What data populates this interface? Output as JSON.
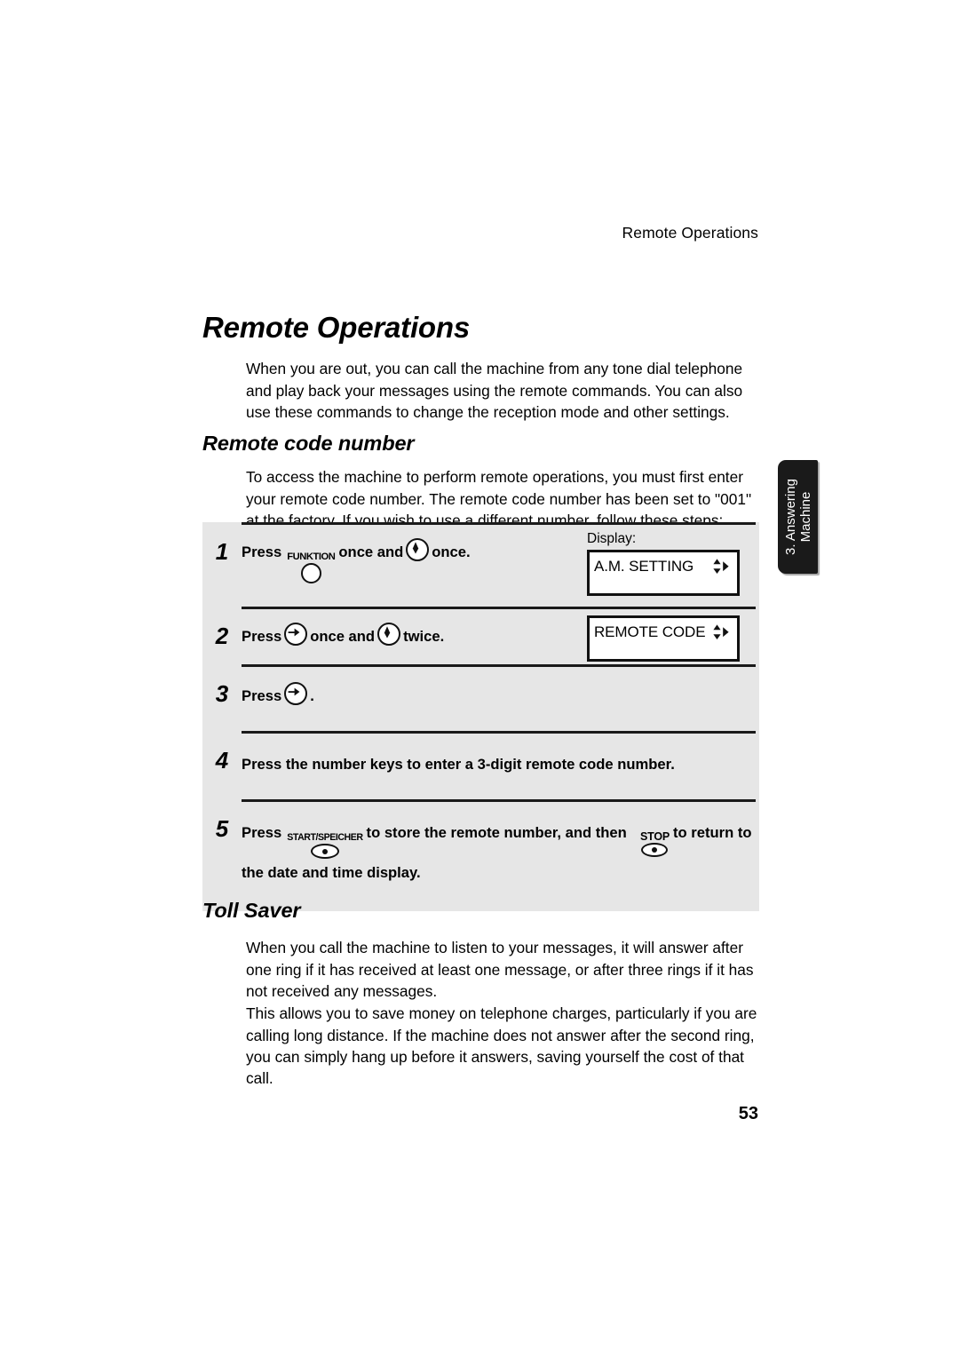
{
  "header": {
    "running_title": "Remote Operations"
  },
  "chapter": {
    "title": "Remote Operations"
  },
  "intro": {
    "paragraph": "When you are out, you can call the machine from any tone dial telephone and play back your messages using the remote commands. You can also use these commands to change the reception mode and other settings."
  },
  "remote_code": {
    "heading": "Remote code number",
    "paragraph": "To access the machine to perform remote operations, you must first enter your remote code number. The remote code number has been set to \"001\" at the factory. If you wish to use a different number, follow these steps:",
    "display_label": "Display:",
    "steps": [
      {
        "num": "1",
        "text_before": "Press",
        "key1_label": "FUNKTION",
        "text_mid": "once and",
        "key2_icon": "down-arrow-key-icon",
        "text_after": "once.",
        "display": "A.M. SETTING"
      },
      {
        "num": "2",
        "text_before": "Press",
        "key1_icon": "right-arrow-key-icon",
        "text_mid": "once and",
        "key2_icon": "down-arrow-key-icon",
        "text_after": "twice.",
        "display": "REMOTE CODE"
      },
      {
        "num": "3",
        "text_before": "Press",
        "key1_icon": "right-arrow-key-icon",
        "text_after": "."
      },
      {
        "num": "4",
        "text_full": "Press the number keys to enter a 3-digit remote code number."
      },
      {
        "num": "5",
        "text_before": "Press",
        "key1_label": "START/SPEICHER",
        "text_mid": "to store the remote number, and then",
        "key2_label": "STOP",
        "text_after": "to return to",
        "text_line2": "the date and time display."
      }
    ]
  },
  "toll_saver": {
    "heading": "Toll Saver",
    "paragraph_1": "When you call the machine to listen to your messages, it will answer after one ring if it has received at least one message, or after three rings if it has not received any messages.",
    "paragraph_2": "This allows you to save money on telephone charges, particularly if you are calling long distance. If the machine does not answer after the second ring, you can simply hang up before it answers, saving yourself the cost of that call."
  },
  "side_tab": {
    "line_1": "3. Answering",
    "line_2": "Machine"
  },
  "footer": {
    "page_number": "53"
  },
  "colors": {
    "table_background": "#e6e6e6",
    "rule": "#1a1a1a",
    "side_tab_background": "#1a1a1a",
    "side_tab_text": "#ffffff",
    "page_background": "#ffffff"
  }
}
